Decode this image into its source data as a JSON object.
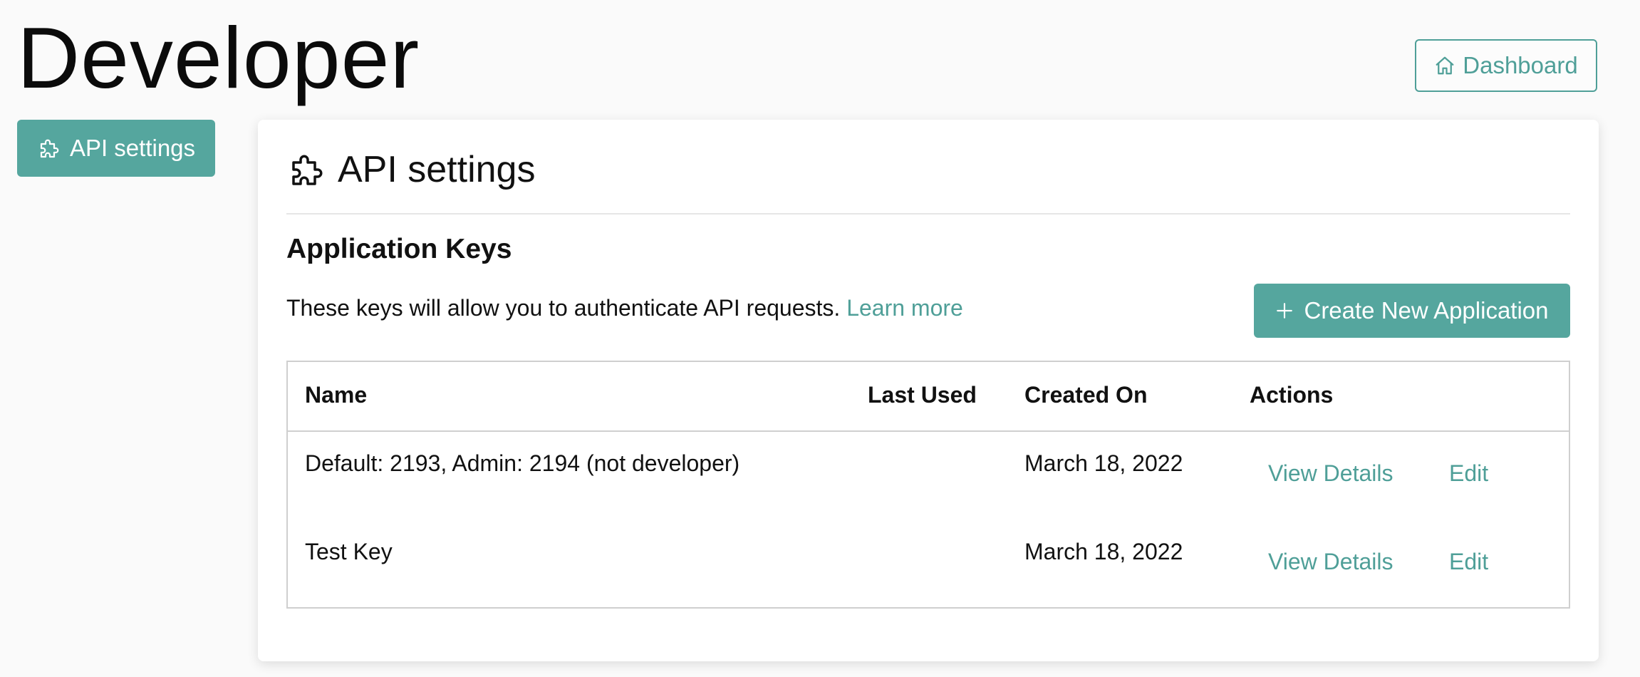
{
  "page": {
    "title": "Developer"
  },
  "header": {
    "dashboard_label": "Dashboard"
  },
  "sidebar": {
    "items": [
      {
        "label": "API settings",
        "active": true
      }
    ]
  },
  "card": {
    "title": "API settings",
    "section_title": "Application Keys",
    "description": "These keys will allow you to authenticate API requests.",
    "learn_more": "Learn more",
    "create_button": "Create New Application"
  },
  "table": {
    "columns": [
      "Name",
      "Last Used",
      "Created On",
      "Actions"
    ],
    "rows": [
      {
        "name": "Default: 2193, Admin: 2194 (not developer)",
        "last_used": "",
        "created_on": "March 18, 2022",
        "actions": [
          "View Details",
          "Edit"
        ]
      },
      {
        "name": "Test Key",
        "last_used": "",
        "created_on": "March 18, 2022",
        "actions": [
          "View Details",
          "Edit"
        ]
      }
    ]
  },
  "icons": {
    "dashboard": "home-icon",
    "api_settings": "puzzle-icon",
    "create": "plus-icon"
  },
  "colors": {
    "accent": "#55a69e",
    "link": "#4f9f98",
    "text": "#111111",
    "background": "#fafafa"
  }
}
